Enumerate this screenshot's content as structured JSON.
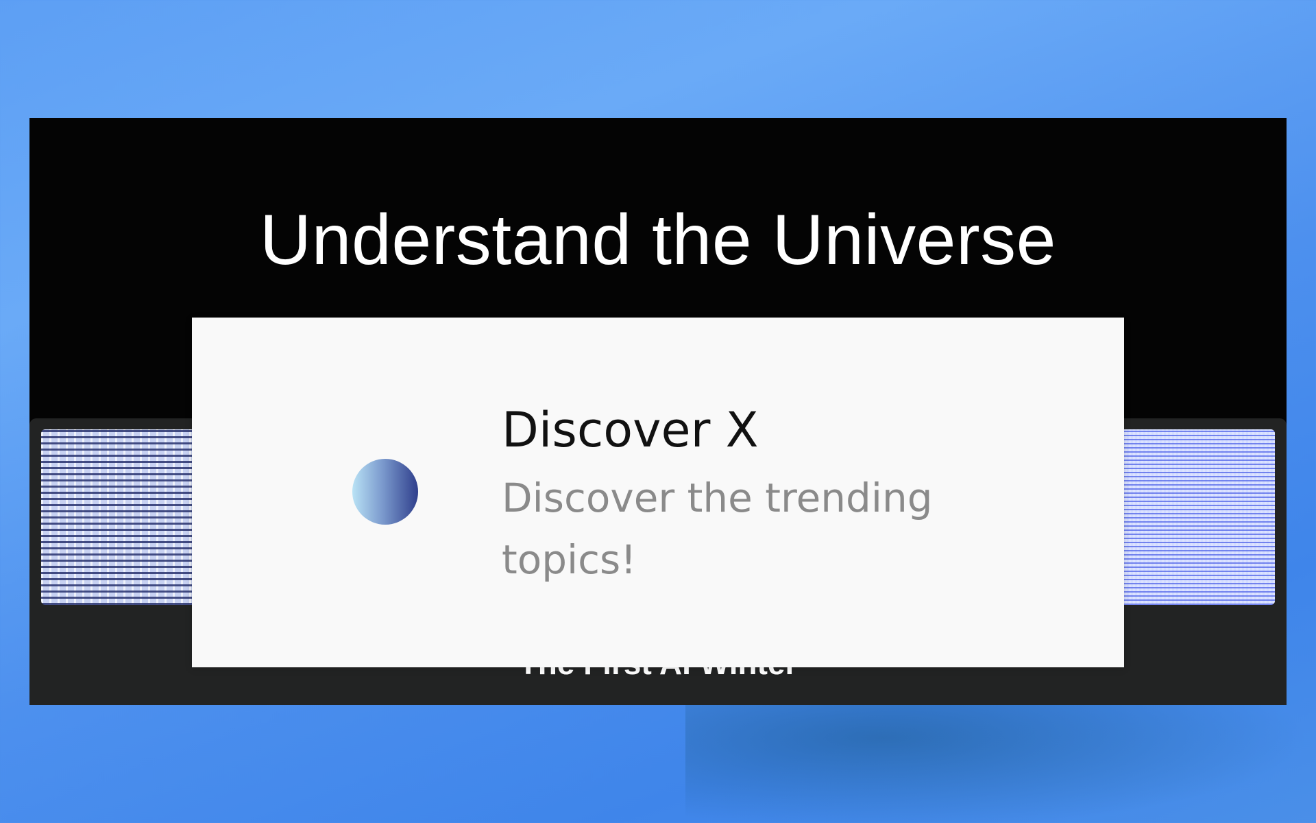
{
  "window": {
    "hero_title": "Understand the Universe",
    "card_caption": "The First AI Winter"
  },
  "notification": {
    "app_icon": "discover-app-icon",
    "title": "Discover X",
    "body": "Discover the trending topics!"
  },
  "colors": {
    "window_background": "#040404",
    "card_background": "#222323",
    "toast_background": "#f9f9f9",
    "toast_body_text": "#8a8a8a"
  }
}
